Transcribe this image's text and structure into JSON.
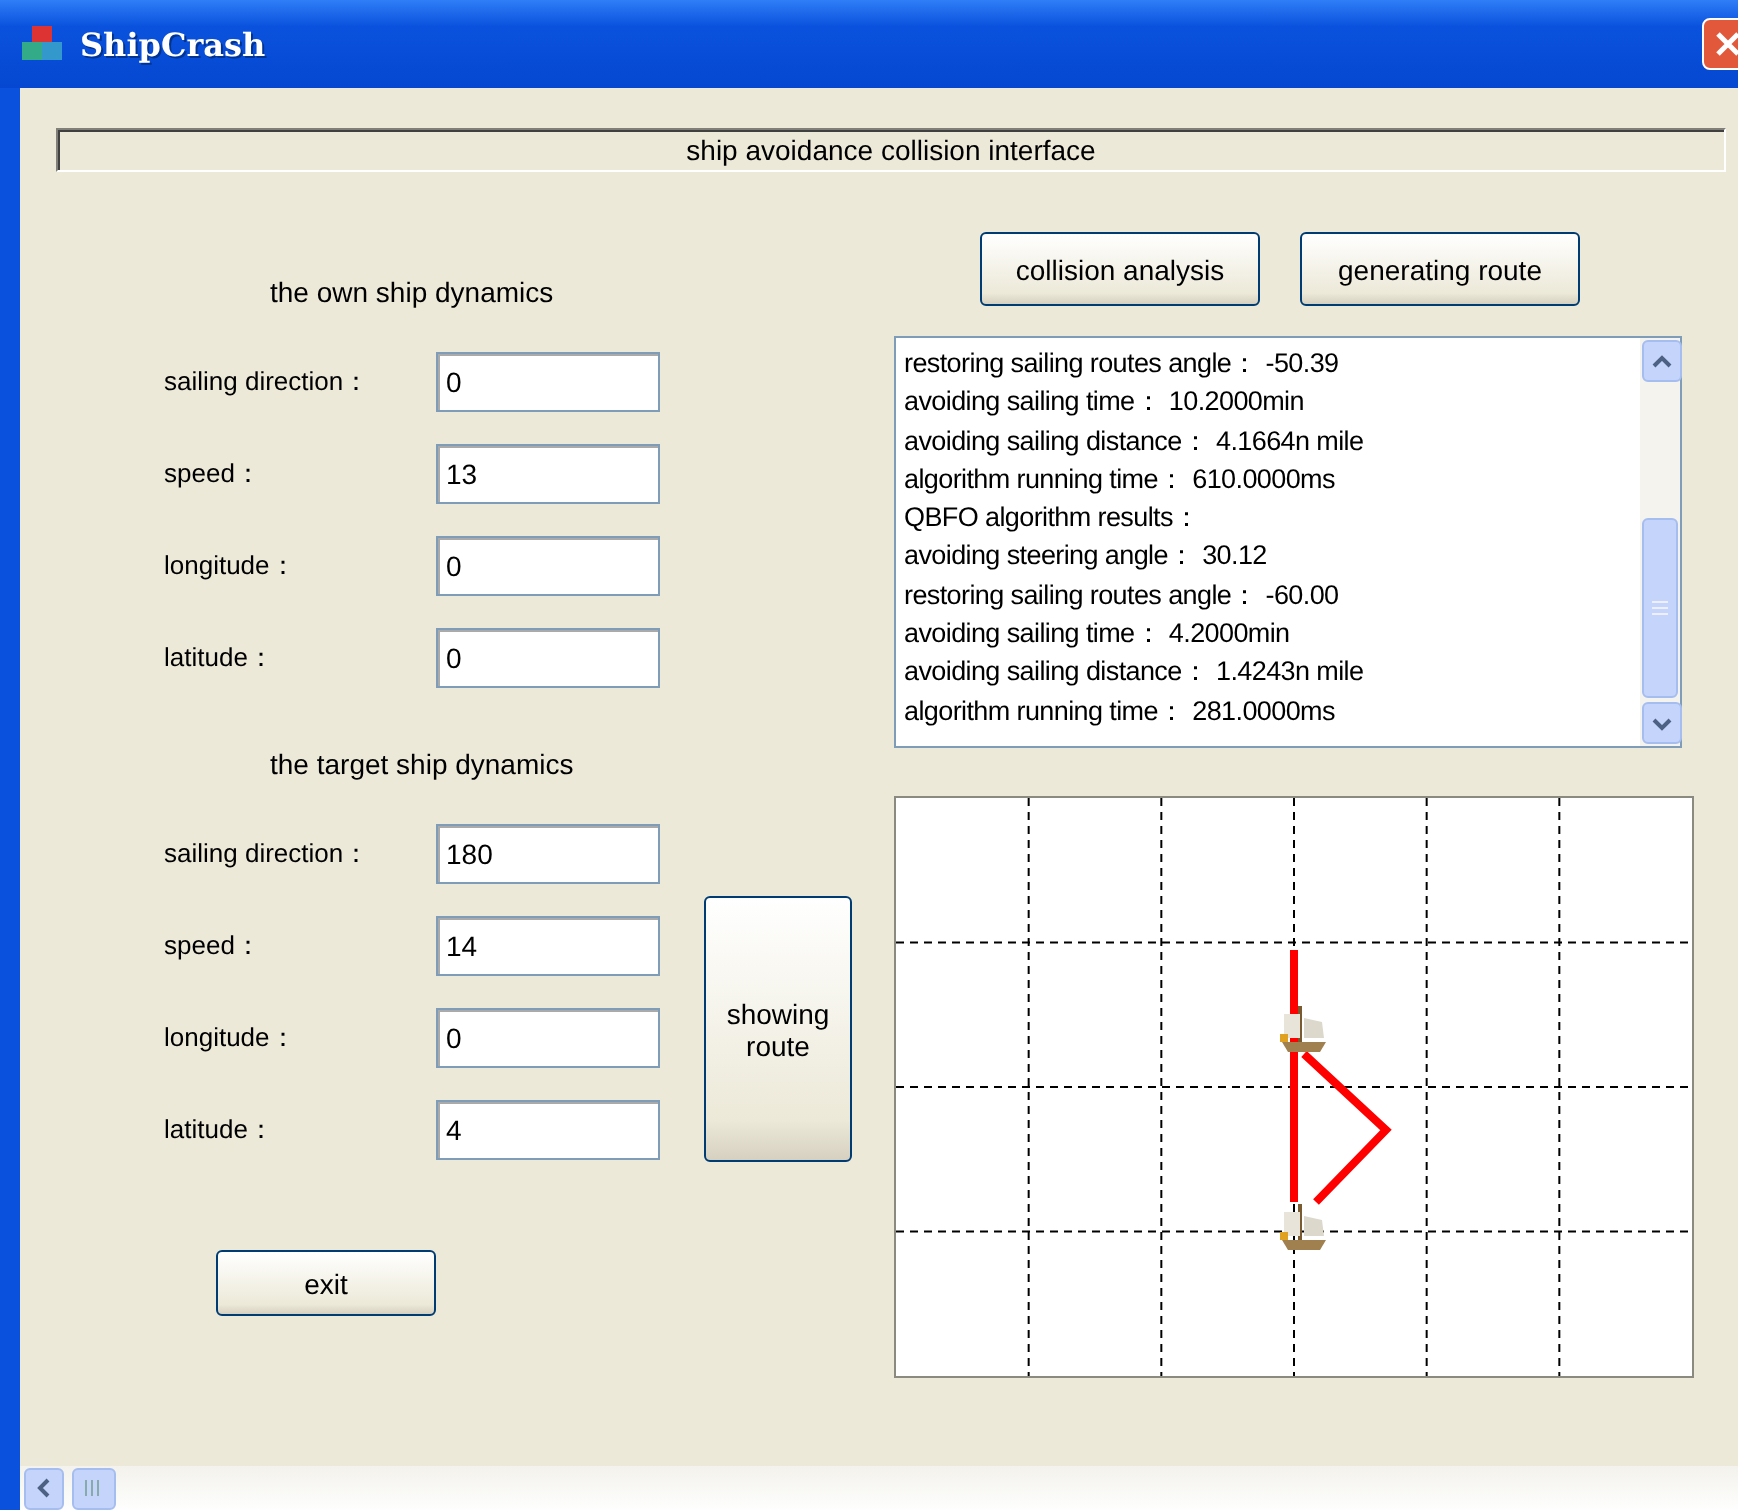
{
  "window": {
    "title": "ShipCrash"
  },
  "header": "ship avoidance collision interface",
  "own_ship": {
    "title": "the own ship dynamics",
    "fields": [
      {
        "label": "sailing direction：",
        "value": "0"
      },
      {
        "label": "speed：",
        "value": "13"
      },
      {
        "label": "longitude：",
        "value": "0"
      },
      {
        "label": "latitude：",
        "value": "0"
      }
    ]
  },
  "target_ship": {
    "title": "the target ship dynamics",
    "fields": [
      {
        "label": "sailing direction：",
        "value": "180"
      },
      {
        "label": "speed：",
        "value": "14"
      },
      {
        "label": "longitude：",
        "value": "0"
      },
      {
        "label": "latitude：",
        "value": "4"
      }
    ]
  },
  "actions": [
    "collision analysis",
    "generating route"
  ],
  "results": [
    "restoring sailing routes angle： -50.39",
    "avoiding sailing time： 10.2000min",
    "avoiding sailing distance： 4.1664n mile",
    "algorithm running time： 610.0000ms",
    "QBFO algorithm results：",
    "avoiding steering angle： 30.12",
    "restoring sailing routes angle： -60.00",
    "avoiding sailing time： 4.2000min",
    "avoiding sailing distance： 1.4243n mile",
    "algorithm running time： 281.0000ms"
  ],
  "show_button": "showing route",
  "exit_button": "exit"
}
